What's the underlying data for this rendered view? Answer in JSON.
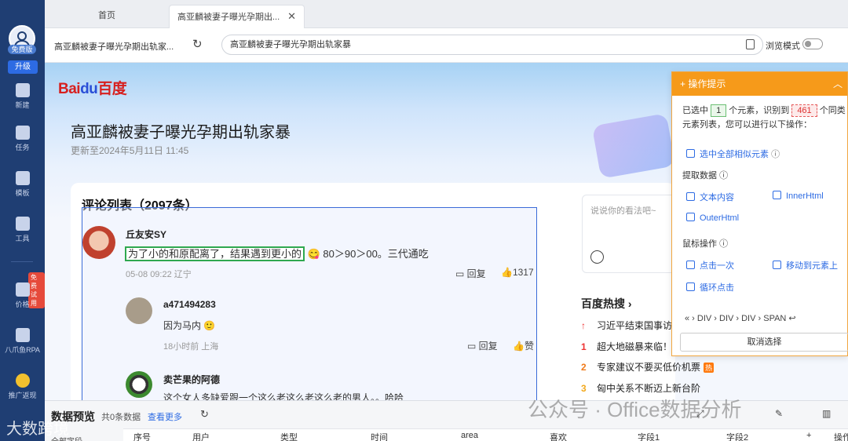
{
  "sidebar": {
    "edition_badge": "免费版",
    "upgrade": "升级",
    "items": [
      {
        "label": "新建",
        "icon": "plus-square-icon"
      },
      {
        "label": "任务",
        "icon": "flag-icon"
      },
      {
        "label": "模板",
        "icon": "template-icon"
      },
      {
        "label": "工具",
        "icon": "toolbox-icon"
      },
      {
        "label": "价格",
        "icon": "price-tag-icon"
      },
      {
        "label": "八爪鱼RPA",
        "icon": "octopus-icon"
      },
      {
        "label": "推广返现",
        "icon": "coin-icon"
      }
    ],
    "trial_badge": "免费试用"
  },
  "tabs": [
    {
      "label": "首页"
    },
    {
      "label": "高亚麟被妻子曝光孕期出..."
    }
  ],
  "address": {
    "page_title": "高亚麟被妻子曝光孕期出轨家...",
    "url": "高亚麟被妻子曝光孕期出轨家暴",
    "browse_mode": "浏览模式"
  },
  "page": {
    "logo_a": "Bai",
    "logo_b": "du",
    "logo_c": "百度",
    "title": "高亚麟被妻子曝光孕期出轨家暴",
    "updated": "更新至2024年5月11日 11:45",
    "comments_title": "评论列表（2097条）",
    "comments": [
      {
        "user": "丘友安SY",
        "text_hl": "为了小的和原配离了，结果遇到更小的",
        "text_rest": " 😋 80＞90＞00。三代通吃",
        "meta": "05-08 09:22  辽宁",
        "reply": "回复",
        "likes": "1317"
      },
      {
        "user": "a471494283",
        "text": "因为马内 🙂",
        "meta": "18小时前  上海",
        "reply": "回复",
        "likes": "赞"
      },
      {
        "user": "卖芒果的阿德",
        "text": "这个女人多缺爱跟一个这么老这么老这么老的男人。。哈哈"
      }
    ],
    "comment_placeholder": "说说你的看法吧~",
    "hot_title": "百度热搜 ›",
    "hot_items": [
      {
        "rank": "↑",
        "text": "习近平结束国事访",
        "tag": ""
      },
      {
        "rank": "1",
        "text": "超大地磁暴来临！",
        "tag": ""
      },
      {
        "rank": "2",
        "text": "专家建议不要买低价机票",
        "tag": "热"
      },
      {
        "rank": "3",
        "text": "匈中关系不断迈上新台阶",
        "tag": ""
      }
    ]
  },
  "panel": {
    "title": "操作提示",
    "selected_prefix": "已选中",
    "selected_count": "1",
    "selected_mid": "个元素，识别到",
    "similar_count": "461",
    "selected_suffix": "个同类元素列表，您可以进行以下操作：",
    "select_all": "选中全部相似元素",
    "extract_title": "提取数据",
    "text_content": "文本内容",
    "inner_html": "InnerHtml",
    "outer_html": "OuterHtml",
    "mouse_title": "鼠标操作",
    "click_once": "点击一次",
    "move_to": "移动到元素上",
    "loop_click": "循环点击",
    "crumbs": "«  ›  DIV  ›  DIV  ›  DIV  ›  SPAN  ↩",
    "cancel": "取消选择"
  },
  "bottom": {
    "title": "数据预览",
    "count": "共0条数据",
    "view_more": "查看更多",
    "columns": [
      "序号",
      "用户",
      "类型",
      "时间",
      "area",
      "喜欢",
      "字段1",
      "字段2",
      "+",
      "操作"
    ],
    "all_fields": "全部字段"
  },
  "watermark": "公众号 · Office数据分析",
  "watermark2": "大数跨境",
  "colors": {
    "sidebar": "#1f3e73",
    "accent": "#2d6be3",
    "panel_header": "#f69a1a",
    "baidu_red": "#d7201f",
    "baidu_blue": "#2a4fd7"
  }
}
